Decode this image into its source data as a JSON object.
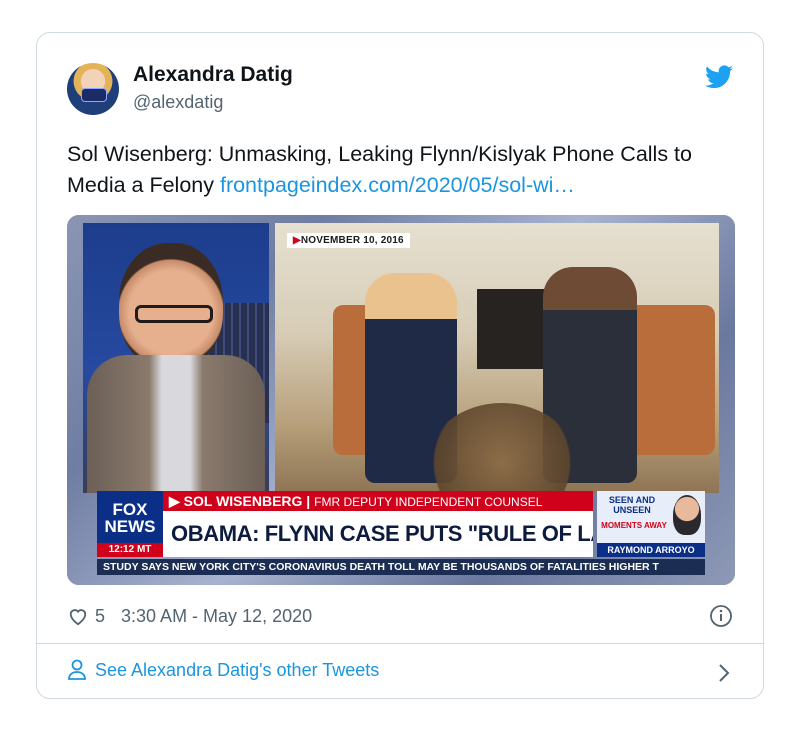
{
  "tweet": {
    "author_name": "Alexandra Datig",
    "author_handle": "@alexdatig",
    "text_plain": "Sol Wisenberg: Unmasking, Leaking Flynn/Kislyak Phone Calls to Media a Felony ",
    "text_link": "frontpageindex.com/2020/05/sol-wi…",
    "likes": "5",
    "timestamp": "3:30 AM - May 12, 2020",
    "footer_link": "See Alexandra Datig's other Tweets"
  },
  "media": {
    "date_bug": "NOVEMBER 10, 2016",
    "network_logo": "FOX NEWS",
    "network_logo_line1": "FOX",
    "network_logo_line2": "NEWS",
    "clock": "12:12 MT",
    "banner_name": "SOL WISENBERG",
    "banner_title": "FMR DEPUTY INDEPENDENT COUNSEL",
    "headline": "OBAMA: FLYNN CASE PUTS \"RULE OF LAW AT RISK\"",
    "promo_top": "SEEN AND UNSEEN",
    "promo_mid": "MOMENTS AWAY",
    "promo_name": "RAYMOND ARROYO",
    "ticker": "STUDY SAYS NEW YORK CITY'S CORONAVIRUS DEATH TOLL MAY BE THOUSANDS OF FATALITIES HIGHER T"
  },
  "colors": {
    "link_blue": "#1b95e0",
    "twitter_blue": "#1da1f2",
    "text_secondary": "#536471",
    "fox_red": "#d0021b",
    "fox_navy": "#0b2f87"
  },
  "icons": [
    "twitter-bird-icon",
    "heart-icon",
    "info-icon",
    "person-icon",
    "chevron-right-icon"
  ]
}
